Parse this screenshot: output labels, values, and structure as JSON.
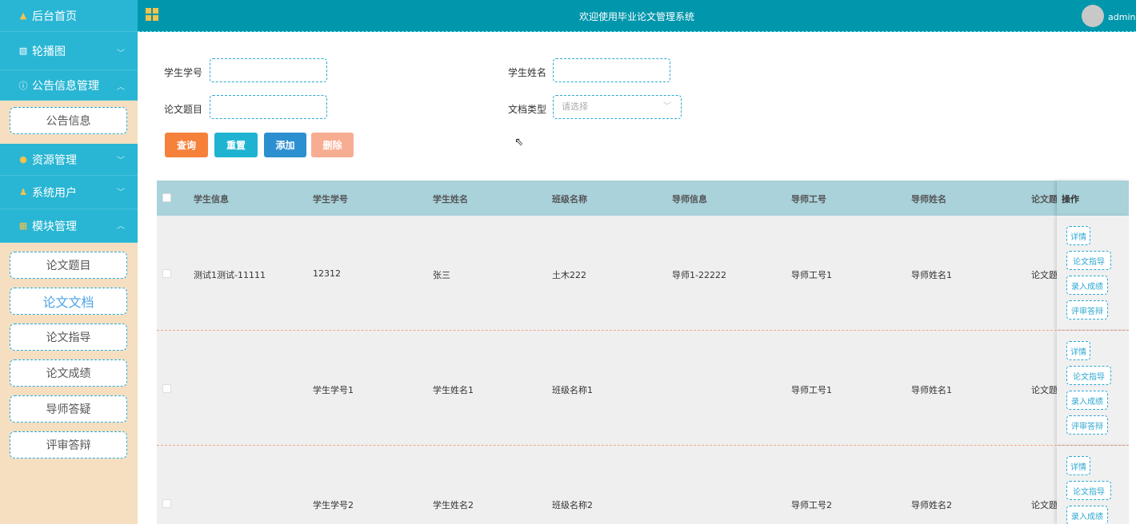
{
  "sidebar": {
    "home": "后台首页",
    "carousel": "轮播图",
    "notice_mgmt": "公告信息管理",
    "notice_sub": [
      "公告信息"
    ],
    "resource_mgmt": "资源管理",
    "system_users": "系统用户",
    "module_mgmt": "模块管理",
    "module_sub": [
      "论文题目",
      "论文文档",
      "论文指导",
      "论文成绩",
      "导师答疑",
      "评审答辩"
    ],
    "active": "论文文档"
  },
  "header": {
    "title": "欢迎使用毕业论文管理系统",
    "user": "admin"
  },
  "search": {
    "student_no_label": "学生学号",
    "student_name_label": "学生姓名",
    "thesis_title_label": "论文题目",
    "doc_type_label": "文档类型",
    "doc_type_placeholder": "请选择"
  },
  "buttons": {
    "query": "查询",
    "reset": "重置",
    "add": "添加",
    "delete": "删除"
  },
  "colors": {
    "accent": "#29b6d4",
    "header": "#0097ad",
    "query": "#f5813b",
    "reset": "#1fb3d1",
    "add": "#2c8fd0",
    "delete": "#f7ad92"
  },
  "table": {
    "columns": [
      "学生信息",
      "学生学号",
      "学生姓名",
      "班级名称",
      "导师信息",
      "导师工号",
      "导师姓名",
      "论文题",
      "操作"
    ],
    "rows": [
      {
        "student_info": "测试1测试-11111",
        "student_no": "12312",
        "student_name": "张三",
        "class_name": "土木222",
        "tutor_info": "导师1-22222",
        "tutor_no": "导师工号1",
        "tutor_name": "导师姓名1",
        "thesis": "论文题"
      },
      {
        "student_info": "",
        "student_no": "学生学号1",
        "student_name": "学生姓名1",
        "class_name": "班级名称1",
        "tutor_info": "",
        "tutor_no": "导师工号1",
        "tutor_name": "导师姓名1",
        "thesis": "论文题"
      },
      {
        "student_info": "",
        "student_no": "学生学号2",
        "student_name": "学生姓名2",
        "class_name": "班级名称2",
        "tutor_info": "",
        "tutor_no": "导师工号2",
        "tutor_name": "导师姓名2",
        "thesis": "论文题"
      }
    ],
    "actions": [
      "详情",
      "论文指导",
      "录入成绩",
      "评审答辩"
    ]
  }
}
